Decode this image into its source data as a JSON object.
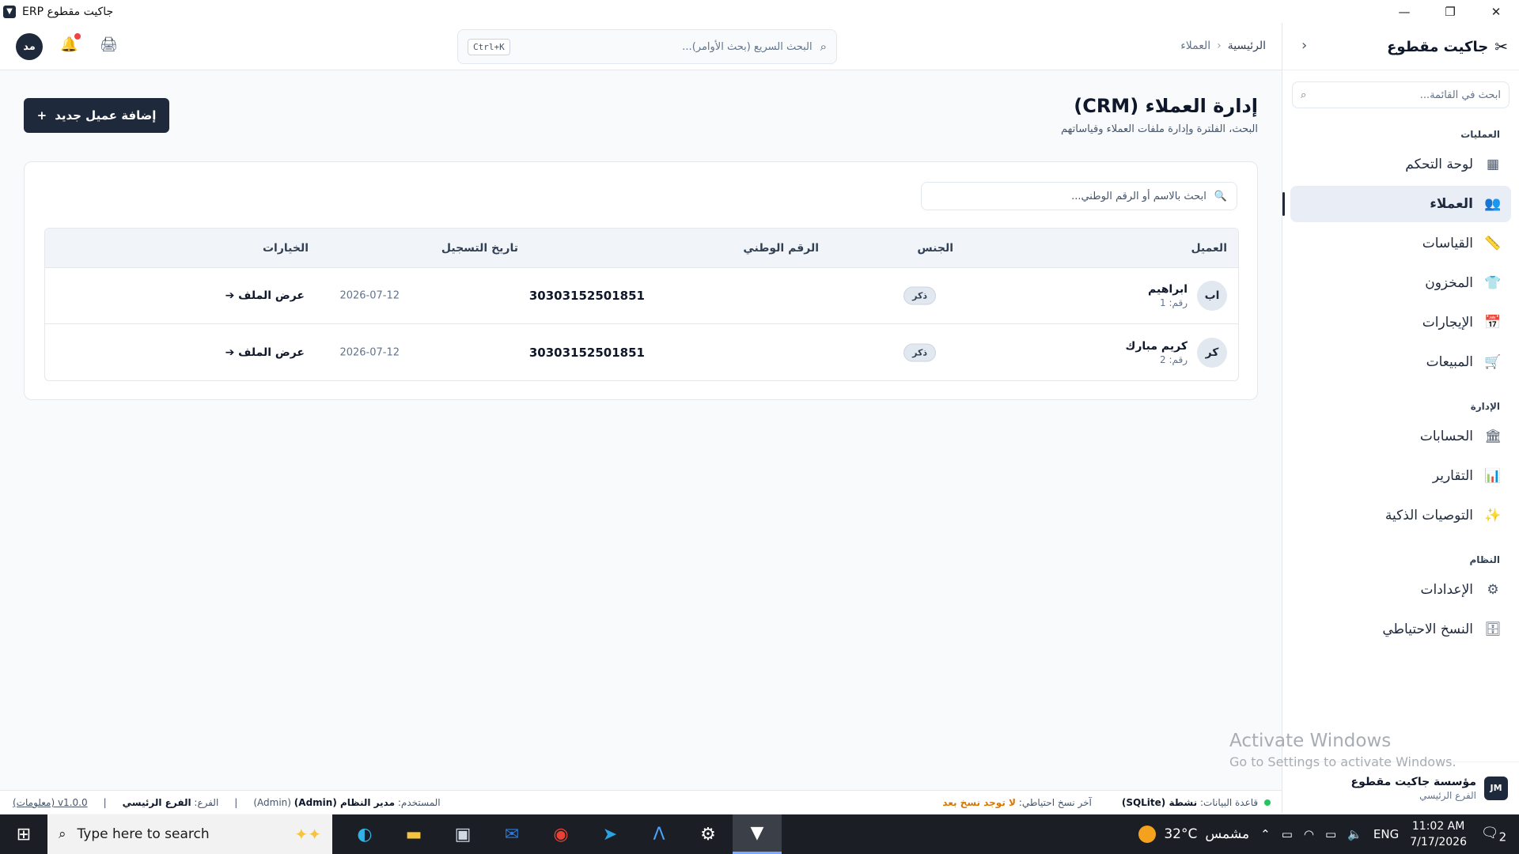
{
  "window": {
    "title": "جاكيت مقطوع ERP",
    "controls": [
      "—",
      "❐",
      "✕"
    ]
  },
  "sidebar": {
    "brand": "جاكيت مقطوع",
    "search_placeholder": "ابحث في القائمة...",
    "sections": [
      {
        "title": "العمليات",
        "items": [
          {
            "label": "لوحة التحكم",
            "icon": "dashboard-icon",
            "active": false
          },
          {
            "label": "العملاء",
            "icon": "users-icon",
            "active": true
          },
          {
            "label": "القياسات",
            "icon": "ruler-icon",
            "active": false
          },
          {
            "label": "المخزون",
            "icon": "shirt-icon",
            "active": false
          },
          {
            "label": "الإيجارات",
            "icon": "calendar-clock-icon",
            "active": false
          },
          {
            "label": "المبيعات",
            "icon": "cart-icon",
            "active": false
          }
        ]
      },
      {
        "title": "الإدارة",
        "items": [
          {
            "label": "الحسابات",
            "icon": "bank-icon",
            "active": false
          },
          {
            "label": "التقارير",
            "icon": "bar-chart-icon",
            "active": false
          },
          {
            "label": "التوصيات الذكية",
            "icon": "sparkles-icon",
            "active": false
          }
        ]
      },
      {
        "title": "النظام",
        "items": [
          {
            "label": "الإعدادات",
            "icon": "gear-icon",
            "active": false
          },
          {
            "label": "النسخ الاحتياطي",
            "icon": "database-icon",
            "active": false
          }
        ]
      }
    ],
    "footer": {
      "logo_text": "JM",
      "org_name": "مؤسسة جاكيت مقطوع",
      "branch": "الفرع الرئيسي"
    }
  },
  "header": {
    "avatar_initials": "مد",
    "quick_search_placeholder": "البحث السريع (بحث الأوامر)...",
    "quick_search_shortcut": "Ctrl+K",
    "breadcrumb": {
      "home": "الرئيسية",
      "current": "العملاء"
    }
  },
  "main": {
    "title": "إدارة العملاء (CRM)",
    "subtitle": "البحث، الفلترة وإدارة ملفات العملاء وقياساتهم",
    "add_button": "إضافة عميل جديد",
    "search_placeholder": "ابحث بالاسم أو الرقم الوطني...",
    "table": {
      "columns": [
        "العميل",
        "الجنس",
        "الرقم الوطني",
        "تاريخ التسجيل",
        "الخيارات"
      ],
      "rows": [
        {
          "initials": "اب",
          "name": "ابراهيم",
          "number": "رقم: 1",
          "gender": "ذكر",
          "national_id": "30303152501851",
          "date": "2026-07-12",
          "action": "عرض الملف ➔"
        },
        {
          "initials": "كر",
          "name": "كريم مبارك",
          "number": "رقم: 2",
          "gender": "ذكر",
          "national_id": "30303152501851",
          "date": "2026-07-12",
          "action": "عرض الملف ➔"
        }
      ]
    }
  },
  "status_bar": {
    "db_label": "قاعدة البيانات:",
    "db_value": "نشطة (SQLite)",
    "backup_label": "آخر نسخ احتياطي:",
    "backup_value": "لا توجد نسخ بعد",
    "user_label": "المستخدم:",
    "user_value": "مدير النظام (Admin)",
    "user_role": "(Admin)",
    "branch_label": "الفرع:",
    "branch_value": "الفرع الرئيسي",
    "version": "v1.0.0 (معلومات)"
  },
  "watermark": {
    "line1": "Activate Windows",
    "line2": "Go to Settings to activate Windows."
  },
  "taskbar": {
    "search_placeholder": "Type here to search",
    "weather_temp": "32°C",
    "weather_desc": "مشمس",
    "language": "ENG",
    "time": "11:02 AM",
    "date": "7/17/2026",
    "notification_count": "2",
    "apps": [
      "edge-icon",
      "file-explorer-icon",
      "computer-icon",
      "outlook-icon",
      "chrome-icon",
      "telegram-icon",
      "app-a-icon",
      "settings-icon",
      "erp-app-icon"
    ]
  },
  "colors": {
    "primary": "#1e293b",
    "active_bg": "#e9eef6",
    "status_ok": "#22c55e",
    "warning": "#d97706",
    "notify": "#ef4444"
  }
}
